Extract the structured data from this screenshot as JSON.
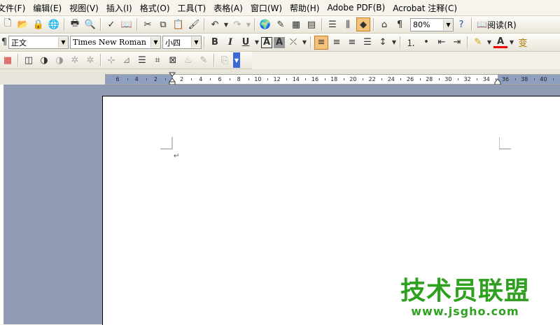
{
  "menubar": {
    "items": [
      "文件(F)",
      "编辑(E)",
      "视图(V)",
      "插入(I)",
      "格式(O)",
      "工具(T)",
      "表格(A)",
      "窗口(W)",
      "帮助(H)",
      "Adobe PDF(B)",
      "Acrobat 注释(C)"
    ]
  },
  "standard_toolbar": {
    "zoom": "80%",
    "reading_label": "阅读(R)"
  },
  "format_toolbar": {
    "style": "正文",
    "font": "Times New Roman",
    "size": "小四",
    "bold": "B",
    "italic": "I",
    "underline": "U",
    "char_border": "A",
    "char_shade": "A",
    "font_color_glyph": "A",
    "phonetic_glyph": "变"
  },
  "ruler": {
    "labels": [
      "6",
      "4",
      "2",
      "2",
      "4",
      "6",
      "8",
      "10",
      "12",
      "14",
      "16",
      "18",
      "20",
      "22",
      "24",
      "26",
      "28",
      "30",
      "32",
      "34",
      "36",
      "38",
      "40"
    ]
  },
  "document": {
    "paragraph_mark": "↵"
  },
  "watermark": {
    "title": "技术员联盟",
    "url": "www.jsgho.com"
  }
}
